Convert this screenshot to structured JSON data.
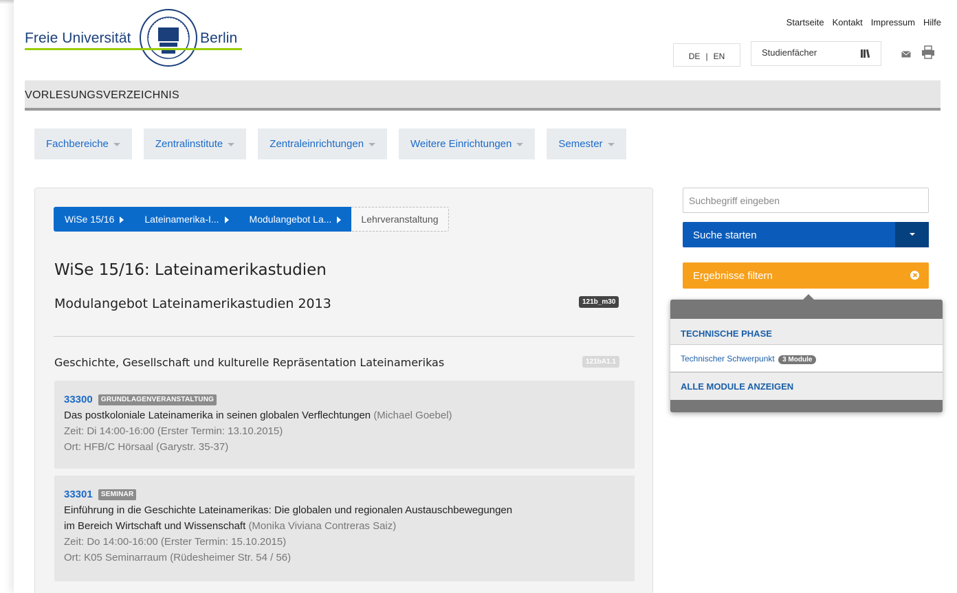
{
  "brand": {
    "word1": "Freie Universität",
    "word2": "Berlin",
    "accent": "#99cc00",
    "navy": "#1a3f7a"
  },
  "toplinks": [
    "Startseite",
    "Kontakt",
    "Impressum",
    "Hilfe"
  ],
  "lang": {
    "de": "DE",
    "sep": "|",
    "en": "EN"
  },
  "studienfaecher": {
    "label": "Studienfächer",
    "icon": "book-icon"
  },
  "icons": {
    "mail": "mail-icon",
    "print": "print-icon"
  },
  "section_title": "VORLESUNGSVERZEICHNIS",
  "nav": [
    {
      "label": "Fachbereiche"
    },
    {
      "label": "Zentralinstitute"
    },
    {
      "label": "Zentraleinrichtungen"
    },
    {
      "label": "Weitere Einrichtungen"
    },
    {
      "label": "Semester"
    }
  ],
  "breadcrumb": [
    "WiSe 15/16",
    "Lateinamerika-I...",
    "Modulangebot La...",
    "Lehrveranstaltung"
  ],
  "heading": "WiSe 15/16: Lateinamerikastudien",
  "subheading": "Modulangebot Lateinamerikastudien 2013",
  "subheading_badge": "121b_m30",
  "module": {
    "title": "Geschichte, Gesellschaft und kulturelle Repräsentation Lateinamerikas",
    "badge": "121bA1.1"
  },
  "courses": [
    {
      "number": "33300",
      "type": "GRUNDLAGENVERANSTALTUNG",
      "title": "Das postkoloniale Lateinamerika in seinen globalen Verflechtungen",
      "lecturer": "(Michael Goebel)",
      "time": "Zeit: Di 14:00-16:00 (Erster Termin: 13.10.2015)",
      "place": "Ort: HFB/C Hörsaal (Garystr. 35-37)"
    },
    {
      "number": "33301",
      "type": "SEMINAR",
      "title_line1": "Einführung in die Geschichte Lateinamerikas: Die globalen und regionalen Austauschbewegungen",
      "title_line2": "im Bereich Wirtschaft und Wissenschaft",
      "lecturer": "(Monika Viviana Contreras Saiz)",
      "time": "Zeit: Do 14:00-16:00 (Erster Termin: 15.10.2015)",
      "place": "Ort: K05 Seminarraum (Rüdesheimer Str. 54 / 56)"
    }
  ],
  "search": {
    "placeholder": "Suchbegriff eingeben",
    "button": "Suche starten"
  },
  "filter": {
    "button": "Ergebnisse filtern",
    "phase_header": "TECHNISCHE PHASE",
    "item_label": "Technischer Schwerpunkt",
    "item_count": "3 Module",
    "show_all": "ALLE MODULE ANZEIGEN"
  },
  "colors": {
    "primary": "#0b6bcb",
    "orange": "#f7a01b",
    "dark_blue": "#06417f"
  }
}
